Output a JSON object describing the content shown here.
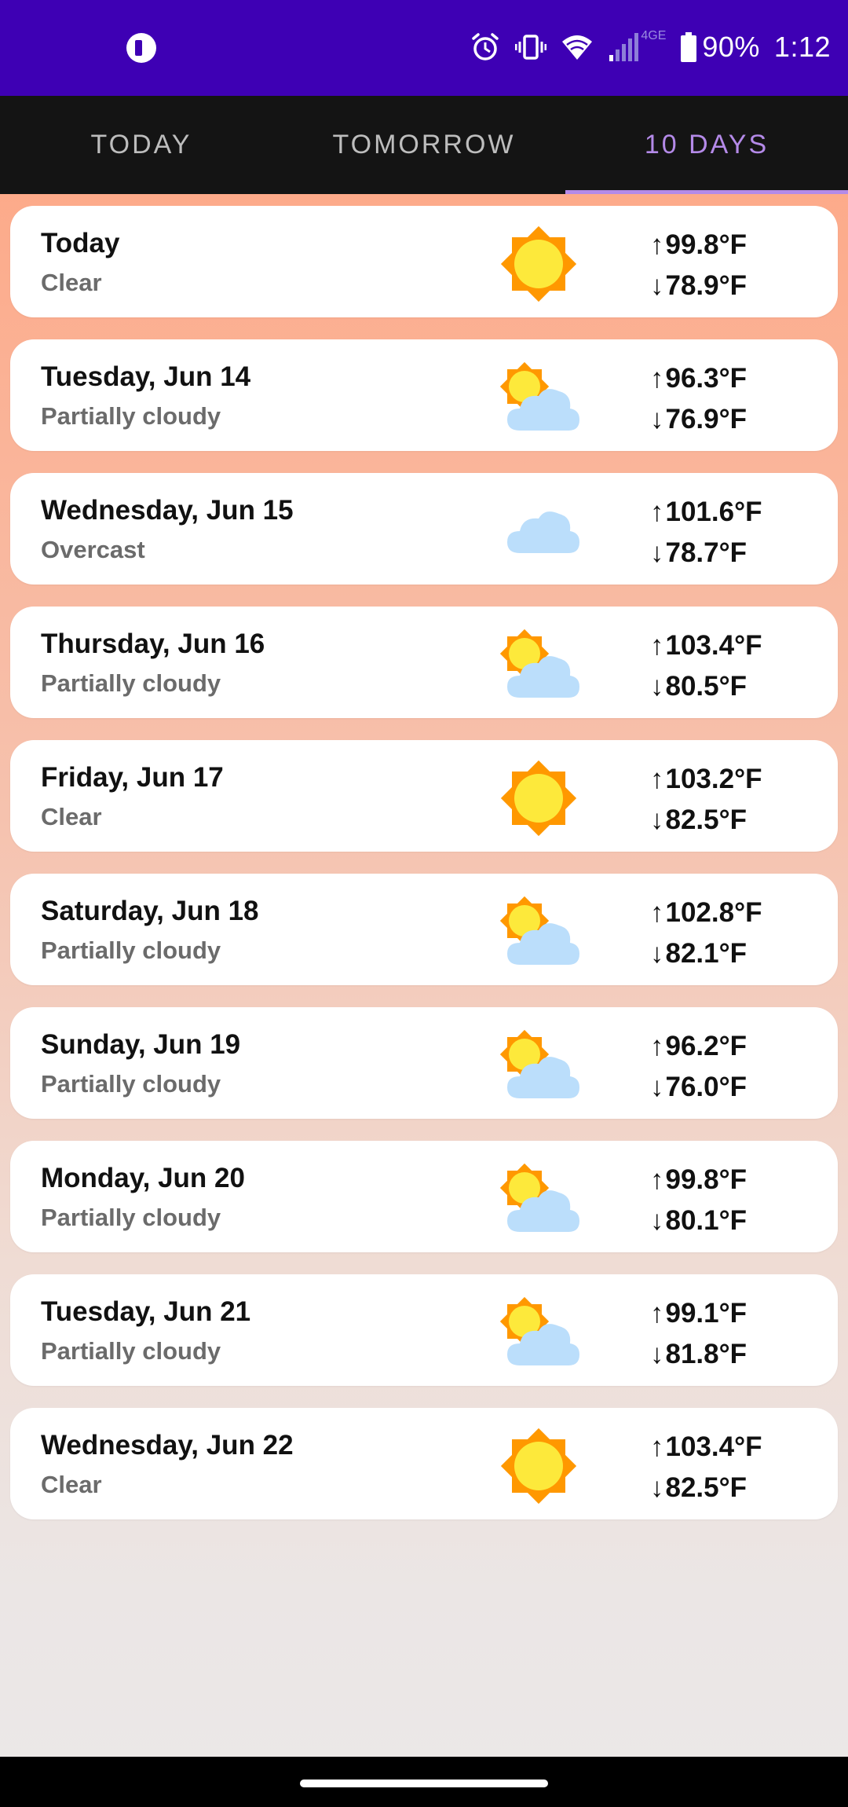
{
  "status_bar": {
    "battery": "90%",
    "time": "1:12",
    "network": "4GE"
  },
  "tabs": [
    {
      "label": "TODAY",
      "active": false
    },
    {
      "label": "TOMORROW",
      "active": false
    },
    {
      "label": "10 DAYS",
      "active": true
    }
  ],
  "colors": {
    "status_bar_bg": "#3e00b4",
    "tab_bar_bg": "#141414",
    "active_tab": "#b48ae8",
    "sun": "#fde93b",
    "sun_rays": "#ff9800",
    "cloud": "#bbdefb"
  },
  "forecast": [
    {
      "day": "Today",
      "condition": "Clear",
      "icon": "sun-icon",
      "high": "99.8°F",
      "low": "78.9°F"
    },
    {
      "day": "Tuesday, Jun 14",
      "condition": "Partially cloudy",
      "icon": "partly-cloudy-icon",
      "high": "96.3°F",
      "low": "76.9°F"
    },
    {
      "day": "Wednesday, Jun 15",
      "condition": "Overcast",
      "icon": "cloud-icon",
      "high": "101.6°F",
      "low": "78.7°F"
    },
    {
      "day": "Thursday, Jun 16",
      "condition": "Partially cloudy",
      "icon": "partly-cloudy-icon",
      "high": "103.4°F",
      "low": "80.5°F"
    },
    {
      "day": "Friday, Jun 17",
      "condition": "Clear",
      "icon": "sun-icon",
      "high": "103.2°F",
      "low": "82.5°F"
    },
    {
      "day": "Saturday, Jun 18",
      "condition": "Partially cloudy",
      "icon": "partly-cloudy-icon",
      "high": "102.8°F",
      "low": "82.1°F"
    },
    {
      "day": "Sunday, Jun 19",
      "condition": "Partially cloudy",
      "icon": "partly-cloudy-icon",
      "high": "96.2°F",
      "low": "76.0°F"
    },
    {
      "day": "Monday, Jun 20",
      "condition": "Partially cloudy",
      "icon": "partly-cloudy-icon",
      "high": "99.8°F",
      "low": "80.1°F"
    },
    {
      "day": "Tuesday, Jun 21",
      "condition": "Partially cloudy",
      "icon": "partly-cloudy-icon",
      "high": "99.1°F",
      "low": "81.8°F"
    },
    {
      "day": "Wednesday, Jun 22",
      "condition": "Clear",
      "icon": "sun-icon",
      "high": "103.4°F",
      "low": "82.5°F"
    }
  ]
}
